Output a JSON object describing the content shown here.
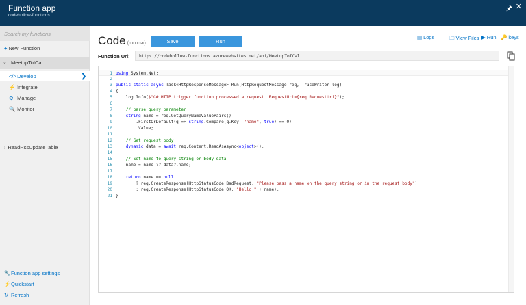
{
  "header": {
    "title": "Function app",
    "subtitle": "codehollow-functions",
    "pin_icon": "pin-icon",
    "close_icon": "close-icon"
  },
  "sidebar": {
    "search_placeholder": "Search my functions",
    "new_function": "New Function",
    "function_name": "MeetupToICal",
    "items": [
      {
        "label": "Develop",
        "icon": "code-icon",
        "active": true
      },
      {
        "label": "Integrate",
        "icon": "lightning-icon",
        "active": false
      },
      {
        "label": "Manage",
        "icon": "gear-icon",
        "active": false
      },
      {
        "label": "Monitor",
        "icon": "search-icon",
        "active": false
      }
    ],
    "other_function": "ReadRssUpdateTable",
    "bottom_links": [
      {
        "label": "Function app settings",
        "icon": "wrench-icon"
      },
      {
        "label": "Quickstart",
        "icon": "lightning-icon"
      },
      {
        "label": "Refresh",
        "icon": "refresh-icon"
      }
    ]
  },
  "main": {
    "title": "Code",
    "file": "(run.csx)",
    "save_label": "Save",
    "run_label": "Run",
    "logs_label": "Logs",
    "view_files_label": "View Files",
    "run_link_label": "Run",
    "keys_label": "keys",
    "url_label": "Function Url:",
    "url_value": "https://codehollow-functions.azurewebsites.net/api/MeetupToICal"
  },
  "code_lines": [
    "using System.Net;",
    "",
    "public static async Task<HttpResponseMessage> Run(HttpRequestMessage req, TraceWriter log)",
    "{",
    "    log.Info($\"C# HTTP trigger function processed a request. RequestUri={req.RequestUri}\");",
    "",
    "    // parse query parameter",
    "    string name = req.GetQueryNameValuePairs()",
    "        .FirstOrDefault(q => string.Compare(q.Key, \"name\", true) == 0)",
    "        .Value;",
    "",
    "    // Get request body",
    "    dynamic data = await req.Content.ReadAsAsync<object>();",
    "",
    "    // Set name to query string or body data",
    "    name = name ?? data?.name;",
    "",
    "    return name == null",
    "        ? req.CreateResponse(HttpStatusCode.BadRequest, \"Please pass a name on the query string or in the request body\")",
    "        : req.CreateResponse(HttpStatusCode.OK, \"Hello \" + name);",
    "}"
  ],
  "colors": {
    "header_bg": "#0b3a5e",
    "accent": "#0072c6",
    "button": "#3a96dd",
    "keyword": "#0000ff",
    "string": "#a31515",
    "comment": "#008000",
    "line_number": "#2b91af"
  }
}
